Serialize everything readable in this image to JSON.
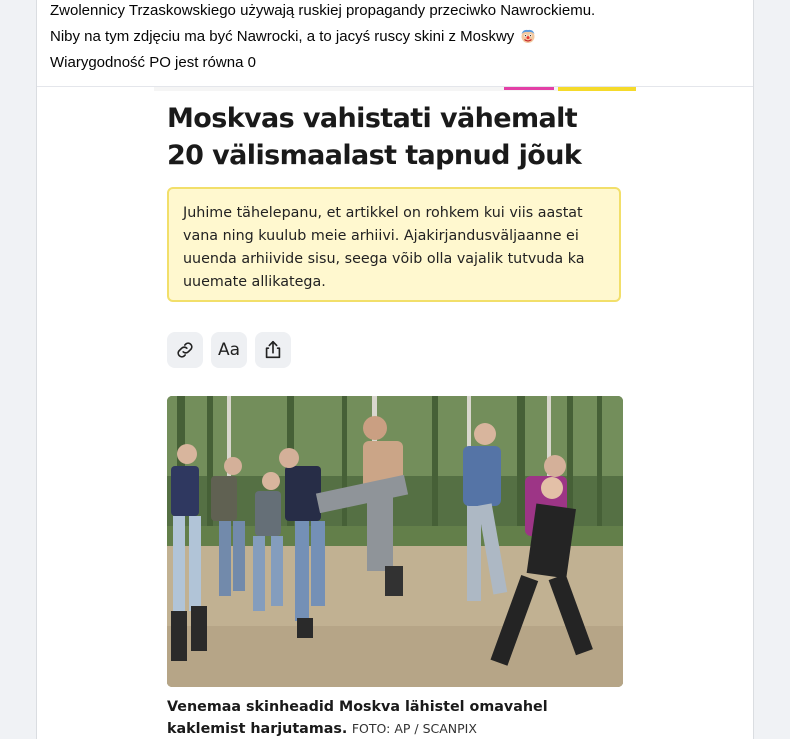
{
  "post": {
    "lines": [
      "Zwolennicy Trzaskowskiego używają ruskiej propagandy przeciwko Nawrockiemu.",
      "Niby na tym zdjęciu ma być Nawrocki, a to jacyś ruscy skini z Moskwy",
      "Wiarygodność PO jest równa 0"
    ],
    "emoji_icon": "clown-face-icon"
  },
  "article": {
    "headline": "Moskvas vahistati vähemalt 20 välismaalast tapnud jõuk",
    "notice": "Juhime tähelepanu, et artikkel on rohkem kui viis aastat vana ning kuulub meie arhiivi. Ajakirjandusväljaanne ei uuenda arhiivide sisu, seega võib olla vajalik tutvuda ka uuemate allikatega.",
    "toolbar": {
      "link_icon": "link-icon",
      "font_label": "Aa",
      "share_icon": "share-icon"
    },
    "photo_alt": "Venemaa skinheadid Moskva lähistel omavahel kaklemist harjutamas.",
    "caption": "Venemaa skinheadid Moskva lähistel omavahel kaklemist harjutamas.",
    "credit": "FOTO: AP / SCANPIX"
  },
  "colors": {
    "notice_bg": "#fff8cf",
    "notice_border": "#f2df6a",
    "brand_pink": "#e33fa6",
    "brand_yellow": "#f5da2b"
  }
}
